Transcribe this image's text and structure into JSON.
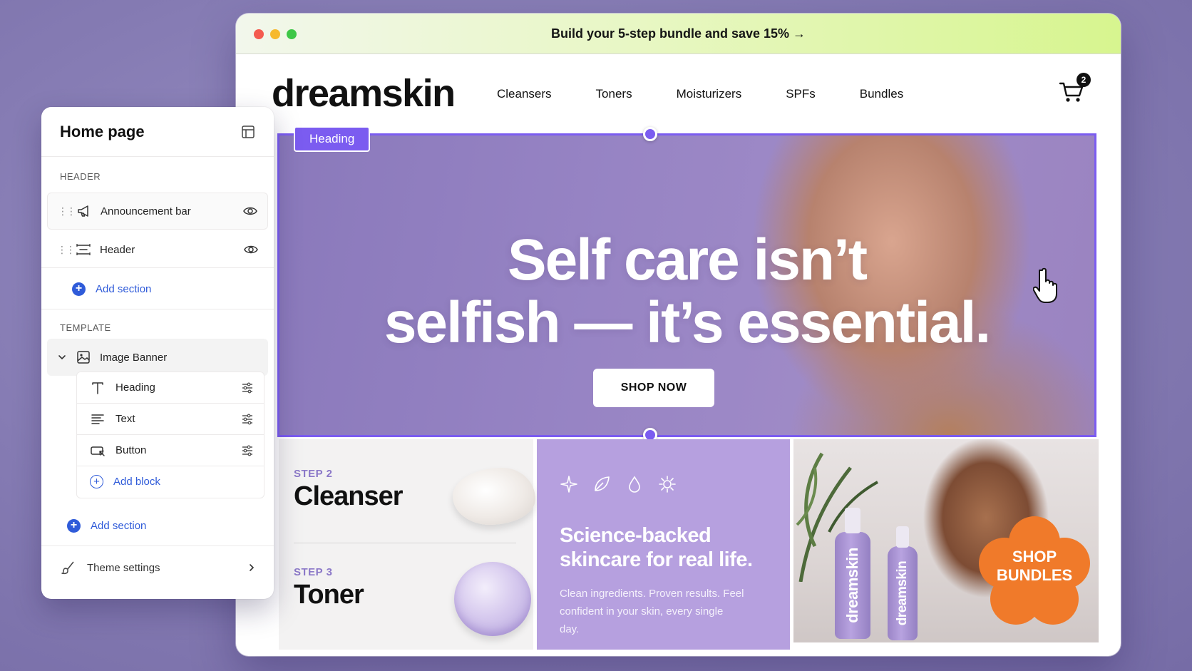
{
  "browser": {
    "announcement": "Build your 5-step bundle and save 15% →"
  },
  "site": {
    "logo": "dreamskin",
    "nav": [
      "Cleansers",
      "Toners",
      "Moisturizers",
      "SPFs",
      "Bundles"
    ],
    "cart_count": "2"
  },
  "hero": {
    "selection_label": "Heading",
    "heading_line1": "Self care isn’t",
    "heading_line2": "selfish — it’s essential.",
    "button": "SHOP NOW"
  },
  "steps": [
    {
      "label": "STEP 2",
      "title": "Cleanser"
    },
    {
      "label": "STEP 3",
      "title": "Toner"
    }
  ],
  "science": {
    "icons": [
      "sparkle-icon",
      "leaf-icon",
      "droplet-icon",
      "sun-icon"
    ],
    "title": "Science-backed skincare for real life.",
    "text": "Clean ingredients. Proven results. Feel confident in your skin, every single day."
  },
  "bundles": {
    "bottle_label": "dreamskin",
    "badge_line1": "SHOP",
    "badge_line2": "BUNDLES"
  },
  "editor": {
    "title": "Home page",
    "header_group": "HEADER",
    "header_items": [
      "Announcement bar",
      "Header"
    ],
    "add_section": "Add section",
    "template_group": "TEMPLATE",
    "section": "Image Banner",
    "blocks": [
      "Heading",
      "Text",
      "Button"
    ],
    "add_block": "Add block",
    "theme_settings": "Theme settings"
  },
  "colors": {
    "accent": "#7b5cf0",
    "link": "#2f5bd9",
    "lavender": "#b6a0df",
    "badge": "#f07a2a"
  }
}
